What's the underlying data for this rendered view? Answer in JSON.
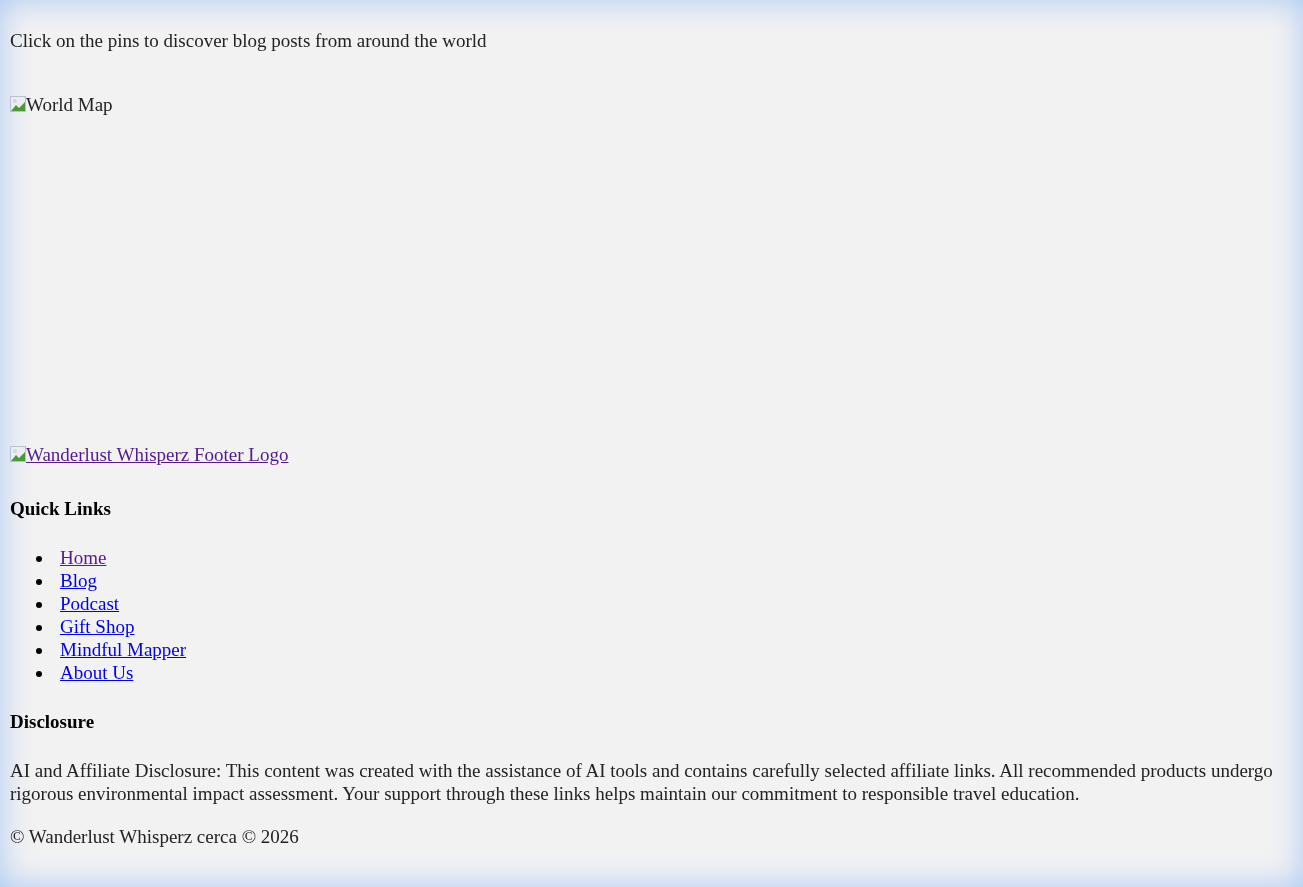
{
  "intro": "Click on the pins to discover blog posts from around the world",
  "map_image": {
    "alt": "World Map"
  },
  "footer_logo": {
    "alt": "Wanderlust Whisperz Footer Logo",
    "visited": true
  },
  "quick_links": {
    "heading": "Quick Links",
    "items": [
      {
        "label": "Home",
        "visited": true
      },
      {
        "label": "Blog",
        "visited": false
      },
      {
        "label": "Podcast",
        "visited": false
      },
      {
        "label": "Gift Shop",
        "visited": false
      },
      {
        "label": "Mindful Mapper",
        "visited": false
      },
      {
        "label": "About Us",
        "visited": false
      }
    ]
  },
  "disclosure": {
    "heading": "Disclosure",
    "text": "AI and Affiliate Disclosure: This content was created with the assistance of AI tools and contains carefully selected affiliate links. All recommended products undergo rigorous environmental impact assessment. Your support through these links helps maintain our commitment to responsible travel education."
  },
  "copyright": "© Wanderlust Whisperz cerca © 2026"
}
